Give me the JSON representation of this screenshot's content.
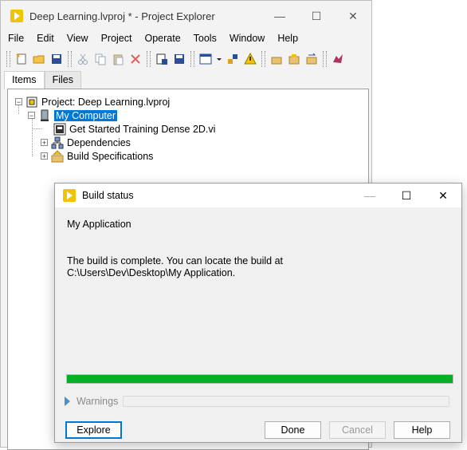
{
  "project_explorer": {
    "title": "Deep Learning.lvproj * - Project Explorer",
    "window_controls": {
      "minimize": "—",
      "maximize": "☐",
      "close": "✕"
    },
    "menu": [
      "File",
      "Edit",
      "View",
      "Project",
      "Operate",
      "Tools",
      "Window",
      "Help"
    ],
    "tabs": [
      "Items",
      "Files"
    ],
    "tree": {
      "root": "Project: Deep Learning.lvproj",
      "computer": "My Computer",
      "children": [
        "Get Started Training Dense 2D.vi",
        "Dependencies",
        "Build Specifications"
      ]
    }
  },
  "build_dialog": {
    "title": "Build status",
    "window_controls": {
      "minimize": "—",
      "maximize": "☐",
      "close": "✕"
    },
    "app_name": "My Application",
    "message_line1": "The build is complete. You can locate the build at",
    "message_line2": "C:\\Users\\Dev\\Desktop\\My Application.",
    "progress": 1.0,
    "warnings_label": "Warnings",
    "buttons": {
      "explore": "Explore",
      "done": "Done",
      "cancel": "Cancel",
      "help": "Help"
    }
  },
  "colors": {
    "selection": "#0078d7",
    "progress": "#06b025",
    "app_icon": "#f0c400"
  }
}
